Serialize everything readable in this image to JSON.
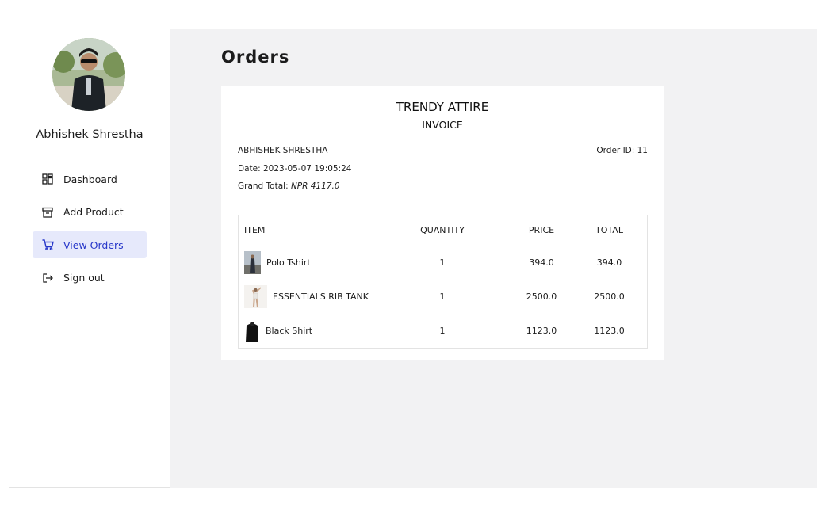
{
  "user": {
    "name": "Abhishek Shrestha"
  },
  "nav": {
    "items": [
      {
        "label": "Dashboard",
        "icon": "dashboard-grid-icon"
      },
      {
        "label": "Add Product",
        "icon": "archive-box-icon"
      },
      {
        "label": "View Orders",
        "icon": "shopping-cart-icon",
        "active": true
      },
      {
        "label": "Sign out",
        "icon": "sign-out-icon"
      }
    ]
  },
  "page": {
    "title": "Orders"
  },
  "invoice": {
    "shop_name": "TRENDY ATTIRE",
    "doc_type": "INVOICE",
    "customer": "ABHISHEK SHRESTHA",
    "order_id_label": "Order ID: 11",
    "date_label": "Date: 2023-05-07 19:05:24",
    "grand_total_label": "Grand Total: ",
    "grand_total_value": "NPR 4117.0",
    "columns": [
      "ITEM",
      "QUANTITY",
      "PRICE",
      "TOTAL"
    ],
    "rows": [
      {
        "item": "Polo Tshirt",
        "quantity": "1",
        "price": "394.0",
        "total": "394.0",
        "thumb": "polo-tshirt-thumbnail"
      },
      {
        "item": "ESSENTIALS RIB TANK",
        "quantity": "1",
        "price": "2500.0",
        "total": "2500.0",
        "thumb": "rib-tank-thumbnail"
      },
      {
        "item": "Black Shirt",
        "quantity": "1",
        "price": "1123.0",
        "total": "1123.0",
        "thumb": "black-shirt-thumbnail"
      }
    ]
  },
  "colors": {
    "accent": "#2737c9",
    "active_bg": "#e6e9fb",
    "main_bg": "#f2f2f3"
  }
}
